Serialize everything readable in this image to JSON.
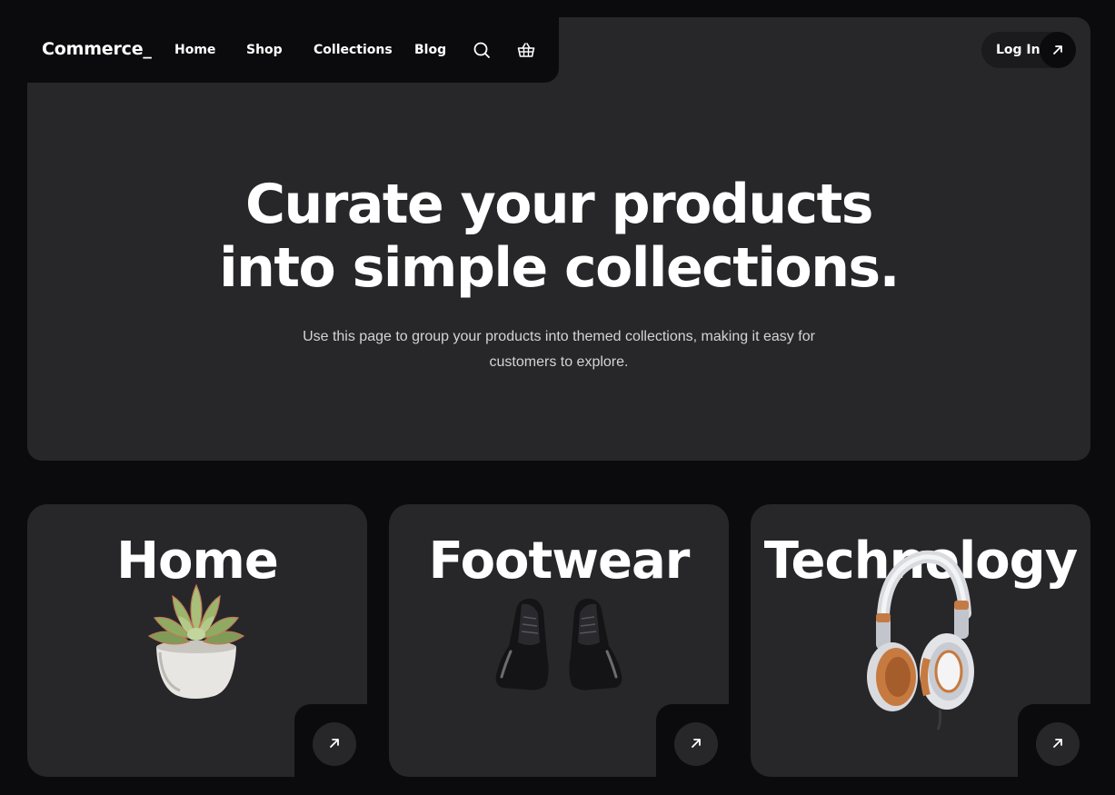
{
  "nav": {
    "brand": "Commerce_",
    "links": [
      "Home",
      "Shop",
      "Collections",
      "Blog"
    ],
    "search_icon": "search-icon",
    "cart_icon": "basket-icon",
    "login_label": "Log In",
    "login_icon": "arrow-up-right-icon"
  },
  "hero": {
    "title_line1": "Curate your products",
    "title_line2": "into simple collections.",
    "subtitle_line1": "Use this page to group your products into themed collections, making it easy for",
    "subtitle_line2": "customers to explore."
  },
  "collections": [
    {
      "title": "Home",
      "image": "succulent-plant-image",
      "icon": "arrow-up-right-icon"
    },
    {
      "title": "Footwear",
      "image": "black-shoes-image",
      "icon": "arrow-up-right-icon"
    },
    {
      "title": "Technology",
      "image": "headphones-image",
      "icon": "arrow-up-right-icon"
    }
  ],
  "colors": {
    "background": "#0b0b0d",
    "panel": "#27272a",
    "text": "#ffffff",
    "muted_text": "#d4d4d8"
  }
}
